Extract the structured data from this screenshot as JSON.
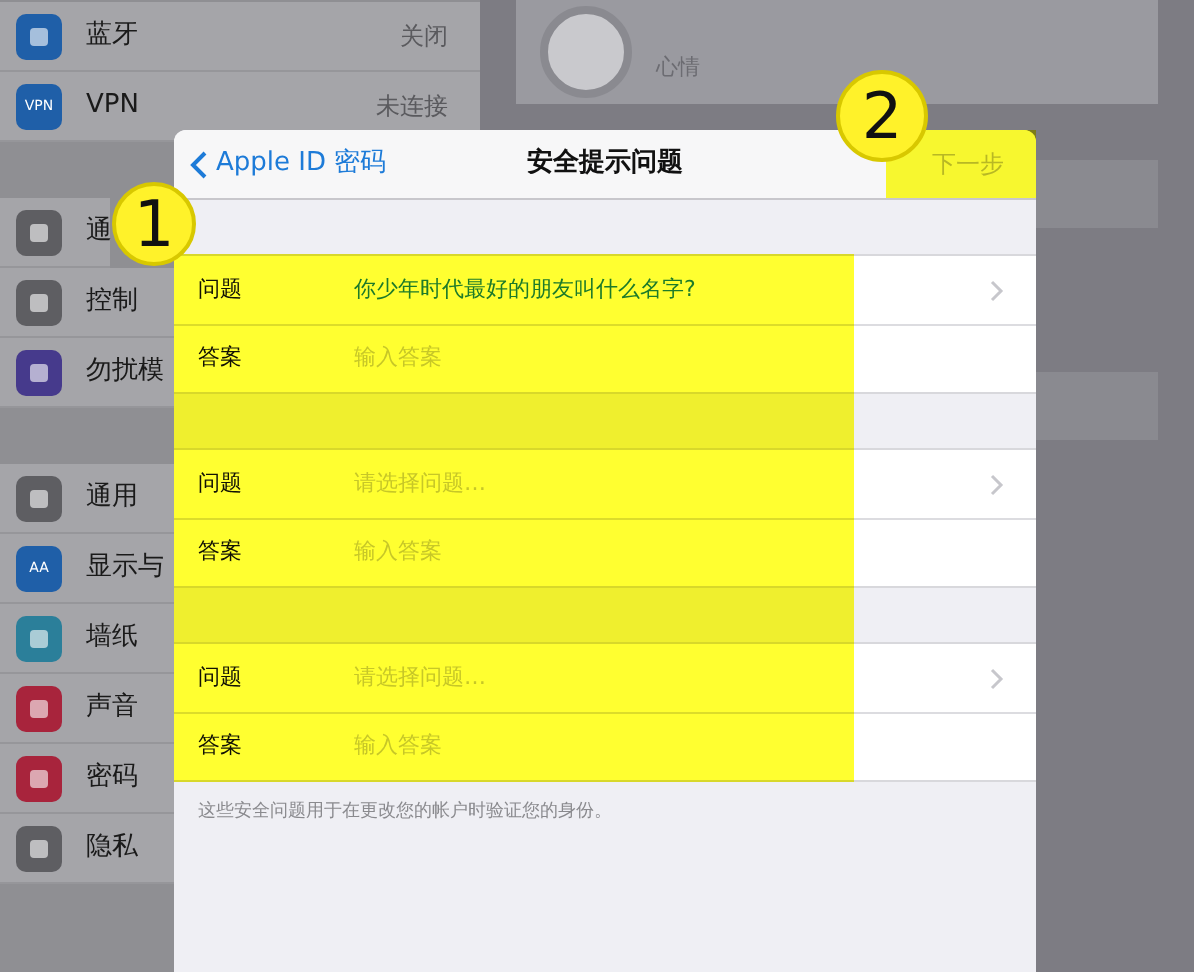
{
  "sidebar": {
    "groups": [
      {
        "items": [
          {
            "label": "蓝牙",
            "value": "关闭",
            "color": "#1f5fa8"
          },
          {
            "label": "VPN",
            "value": "未连接",
            "color": "#1f5fa8",
            "icon_text": "VPN"
          }
        ]
      },
      {
        "items": [
          {
            "label": "通",
            "color": "#5e5e62"
          },
          {
            "label": "控制",
            "color": "#5e5e62"
          },
          {
            "label": "勿扰模",
            "color": "#463a8c"
          }
        ]
      },
      {
        "items": [
          {
            "label": "通用",
            "color": "#5e5e62"
          },
          {
            "label": "显示与",
            "color": "#1f5fa8",
            "icon_text": "AA"
          },
          {
            "label": "墙纸",
            "color": "#2b7f9a"
          },
          {
            "label": "声音",
            "color": "#a8243c"
          },
          {
            "label": "密码",
            "color": "#a8243c"
          },
          {
            "label": "隐私",
            "color": "#5e5e62"
          }
        ]
      }
    ]
  },
  "account": {
    "subtitle": "心情"
  },
  "sheet": {
    "back": "Apple ID 密码",
    "title": "安全提示问题",
    "next": {
      "label": "下一步",
      "disabled": true
    },
    "sections": [
      {
        "rows": [
          {
            "label": "问题",
            "value": "你少年时代最好的朋友叫什么名字?",
            "chevron": true
          },
          {
            "label": "答案",
            "placeholder": "输入答案",
            "chevron": false
          }
        ]
      },
      {
        "rows": [
          {
            "label": "问题",
            "placeholder": "请选择问题…",
            "chevron": true
          },
          {
            "label": "答案",
            "placeholder": "输入答案",
            "chevron": false
          }
        ]
      },
      {
        "rows": [
          {
            "label": "问题",
            "placeholder": "请选择问题…",
            "chevron": true
          },
          {
            "label": "答案",
            "placeholder": "输入答案",
            "chevron": false
          }
        ]
      }
    ],
    "footer": "这些安全问题用于在更改您的帐户时验证您的身份。"
  },
  "annotations": [
    {
      "number": "1"
    },
    {
      "number": "2"
    }
  ]
}
